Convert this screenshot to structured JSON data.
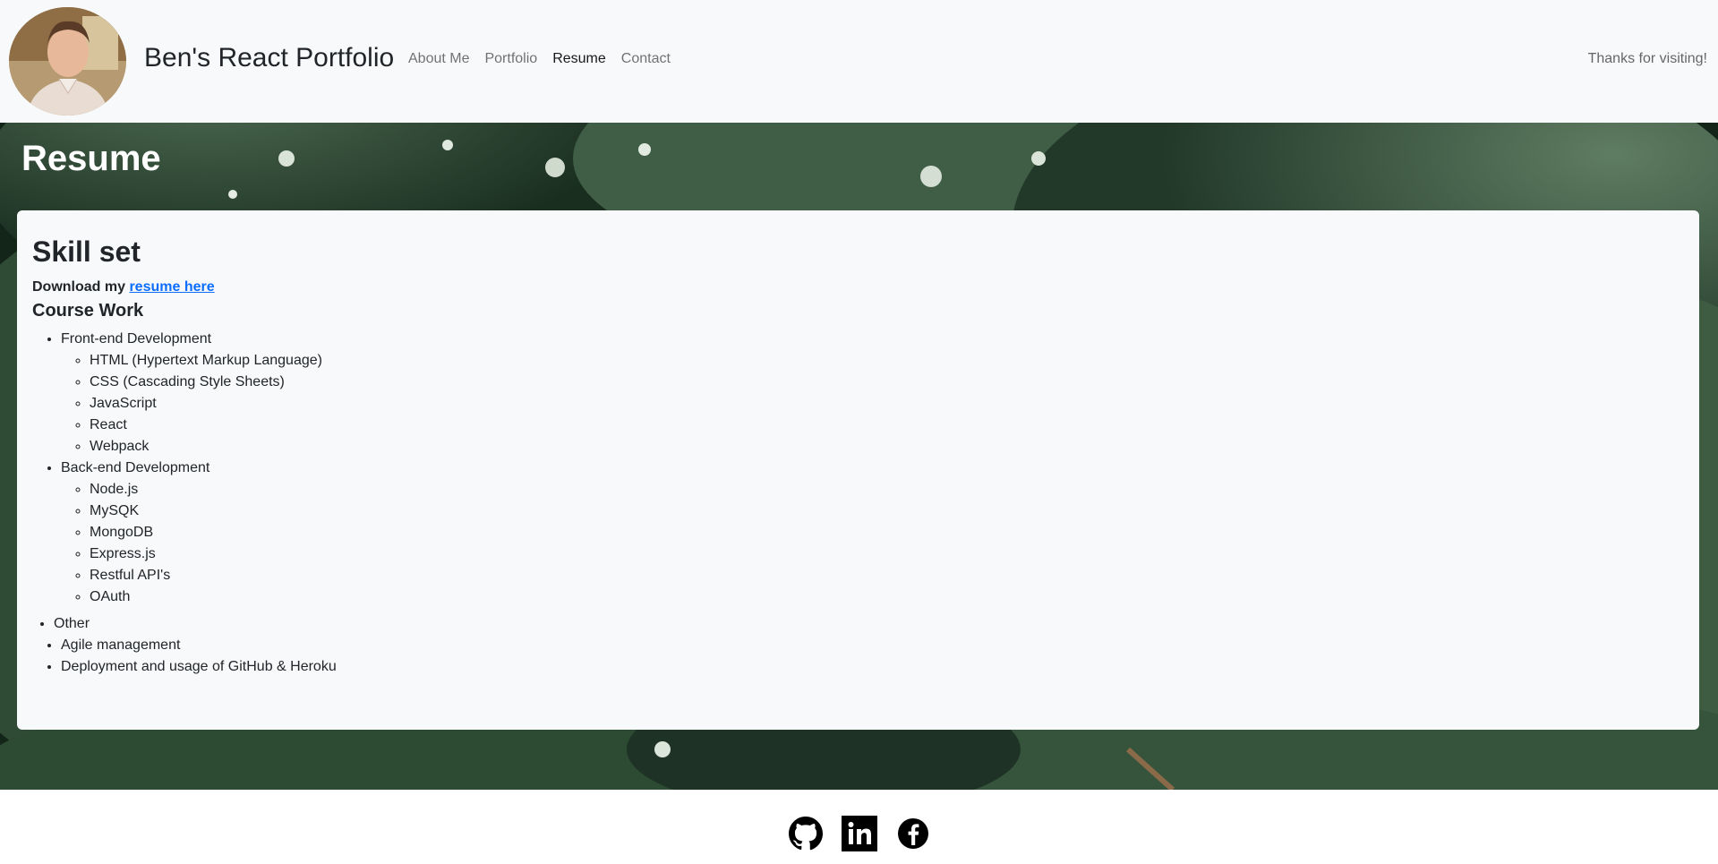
{
  "navbar": {
    "brand": "Ben's React Portfolio",
    "links": [
      {
        "label": "About Me",
        "active": false
      },
      {
        "label": "Portfolio",
        "active": false
      },
      {
        "label": "Resume",
        "active": true
      },
      {
        "label": "Contact",
        "active": false
      }
    ],
    "right_text": "Thanks for visiting!"
  },
  "page": {
    "heading": "Resume"
  },
  "card": {
    "title": "Skill set",
    "download_prefix": "Download my ",
    "download_link": "resume here",
    "coursework_title": "Course Work",
    "frontend": {
      "label": "Front-end Development",
      "items": [
        "HTML (Hypertext Markup Language)",
        "CSS (Cascading Style Sheets)",
        "JavaScript",
        "React",
        "Webpack"
      ]
    },
    "backend": {
      "label": "Back-end Development",
      "items": [
        "Node.js",
        "MySQK",
        "MongoDB",
        "Express.js",
        "Restful API's",
        "OAuth"
      ]
    },
    "other": {
      "label": "Other",
      "items": [
        "Agile management",
        "Deployment and usage of GitHub & Heroku"
      ]
    }
  },
  "footer": {
    "icons": [
      "github-icon",
      "linkedin-icon",
      "facebook-icon"
    ]
  },
  "colors": {
    "navbar_bg": "#f8f9fa",
    "link_blue": "#0d6efd",
    "hero_green": "#1d3323"
  }
}
